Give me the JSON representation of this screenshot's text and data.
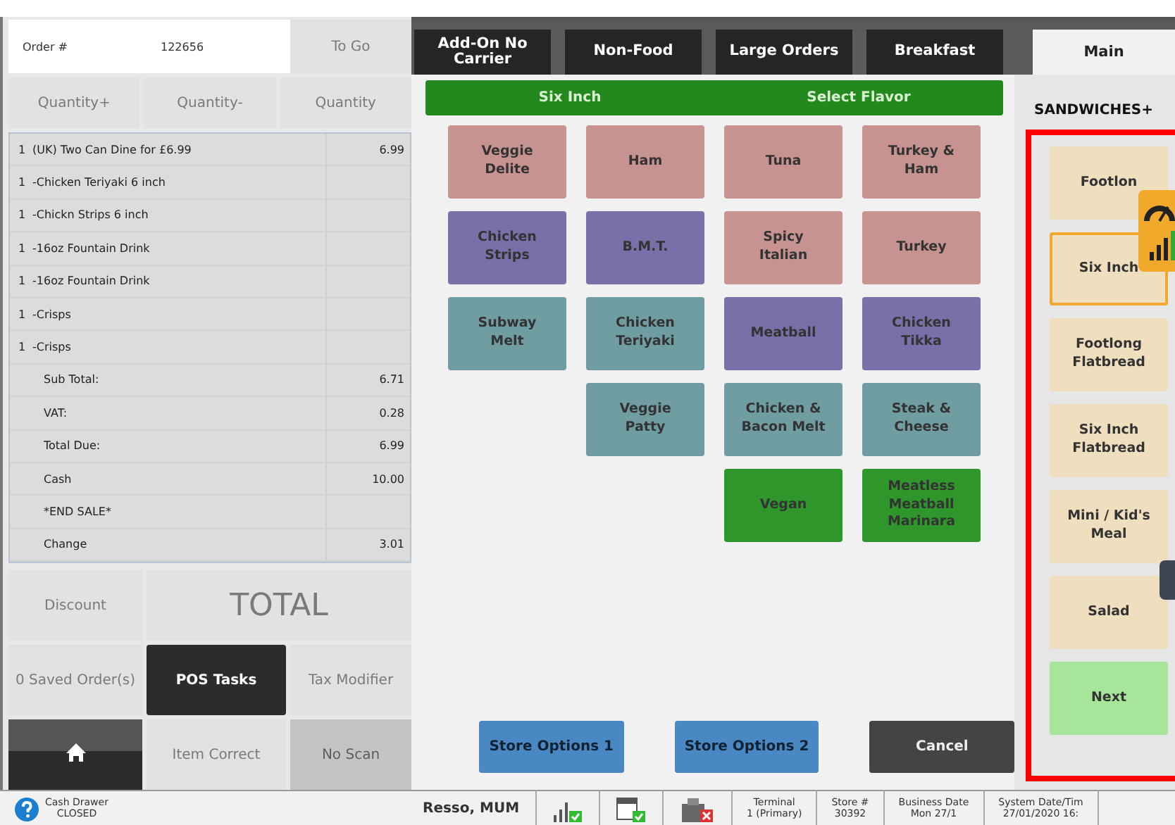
{
  "order_header": {
    "label": "Order #",
    "number": "122656",
    "to_go": {
      "label": "To Go",
      "disabled": true
    }
  },
  "quantity_buttons": [
    {
      "label": "Quantity+",
      "disabled": true
    },
    {
      "label": "Quantity-",
      "disabled": true
    },
    {
      "label": "Quantity",
      "disabled": true
    }
  ],
  "order_lines": [
    {
      "qty": "1",
      "item": "(UK) Two Can Dine for £6.99",
      "price": "6.99"
    },
    {
      "qty": "1",
      "item": "-Chicken Teriyaki 6 inch"
    },
    {
      "qty": "1",
      "item": "-Chickn Strips 6 inch"
    },
    {
      "qty": "1",
      "item": "-16oz Fountain Drink"
    },
    {
      "qty": "1",
      "item": "-16oz Fountain Drink"
    },
    {
      "qty": "1",
      "item": "-Crisps"
    },
    {
      "qty": "1",
      "item": "-Crisps"
    },
    {
      "item": "Sub Total:",
      "price": "6.71"
    },
    {
      "item": "VAT:",
      "price": "0.28"
    },
    {
      "item": "Total Due:",
      "price": "6.99"
    },
    {
      "item": "Cash",
      "price": "10.00"
    },
    {
      "item": "*END SALE*"
    },
    {
      "item": "Change",
      "price": "3.01"
    }
  ],
  "action_buttons": [
    {
      "kind": "text",
      "label": "Discount",
      "disabled": true
    },
    {
      "kind": "total",
      "label": "TOTAL",
      "disabled": true
    },
    {
      "kind": "text",
      "label": "0 Saved Order(s)",
      "disabled": true
    },
    {
      "kind": "text",
      "label": "POS Tasks",
      "disabled": false
    },
    {
      "kind": "text",
      "label": "Tax Modifier",
      "disabled": true
    },
    {
      "kind": "home"
    },
    {
      "kind": "text",
      "label": "Item Correct",
      "disabled": true
    },
    {
      "kind": "text",
      "label": "No Scan",
      "disabled": true
    }
  ],
  "category_tabs": [
    {
      "label": "Add-On No Carrier",
      "selected": false
    },
    {
      "label": "Non-Food",
      "selected": false
    },
    {
      "label": "Large Orders",
      "selected": false
    },
    {
      "label": "Breakfast",
      "selected": false
    }
  ],
  "main_tab": {
    "label": "Main",
    "selected": true
  },
  "banner": {
    "size": "Six Inch",
    "prompt": "Select Flavor"
  },
  "menu_rows": [
    [
      {
        "kind": "item",
        "label": "Veggie Delite",
        "color": "#c79391"
      },
      {
        "kind": "item",
        "label": "Ham",
        "color": "#c79391"
      },
      {
        "kind": "item",
        "label": "Tuna",
        "color": "#c79391"
      },
      {
        "kind": "item",
        "label": "Turkey & Ham",
        "color": "#c79391"
      }
    ],
    [
      {
        "kind": "item",
        "label": "Chicken Strips",
        "color": "#7a6fa8"
      },
      {
        "kind": "item",
        "label": "B.M.T.",
        "color": "#7a6fa8"
      },
      {
        "kind": "item",
        "label": "Spicy Italian",
        "color": "#c79391"
      },
      {
        "kind": "item",
        "label": "Turkey",
        "color": "#c79391"
      }
    ],
    [
      {
        "kind": "item",
        "label": "Subway Melt",
        "color": "#6f9da2"
      },
      {
        "kind": "item",
        "label": "Chicken Teriyaki",
        "color": "#6f9da2"
      },
      {
        "kind": "item",
        "label": "Meatball",
        "color": "#7a6fa8"
      },
      {
        "kind": "item",
        "label": "Chicken Tikka",
        "color": "#7a6fa8"
      }
    ],
    [
      {
        "kind": "blank"
      },
      {
        "kind": "item",
        "label": "Veggie Patty",
        "color": "#6f9da2"
      },
      {
        "kind": "item",
        "label": "Chicken & Bacon Melt",
        "color": "#6f9da2"
      },
      {
        "kind": "item",
        "label": "Steak & Cheese",
        "color": "#6f9da2"
      }
    ],
    [
      {
        "kind": "blank"
      },
      {
        "kind": "blank"
      },
      {
        "kind": "item",
        "label": "Vegan",
        "color": "#2e962b"
      },
      {
        "kind": "item",
        "label": "Meatless Meatball Marinara",
        "color": "#2e962b"
      }
    ]
  ],
  "bottom_buttons": [
    {
      "kind": "store",
      "label": "Store Options 1"
    },
    {
      "kind": "store",
      "label": "Store Options 2"
    },
    {
      "kind": "cancel",
      "label": "Cancel"
    }
  ],
  "sandwich_section": {
    "title": "SANDWICHES+",
    "items": [
      {
        "kind": "size",
        "label": "Footlon",
        "selected": false
      },
      {
        "kind": "size",
        "label": "Six Inch",
        "selected": true
      },
      {
        "kind": "size",
        "label": "Footlong Flatbread",
        "selected": false
      },
      {
        "kind": "size",
        "label": "Six Inch Flatbread",
        "selected": false
      },
      {
        "kind": "size",
        "label": "Mini / Kid's Meal",
        "selected": false
      },
      {
        "kind": "size",
        "label": "Salad",
        "selected": false
      },
      {
        "kind": "next",
        "label": "Next",
        "selected": false
      }
    ]
  },
  "status_bar": {
    "drawer": {
      "title": "Cash Drawer",
      "state": "CLOSED"
    },
    "user": "Resso, MUM",
    "fields": [
      {
        "title": "Terminal",
        "value": "1 (Primary)"
      },
      {
        "title": "Store #",
        "value": "30392"
      },
      {
        "title": "Business Date",
        "value": "Mon 27/1"
      },
      {
        "title": "System Date/Tim",
        "value": "27/01/2020 16:"
      }
    ]
  }
}
